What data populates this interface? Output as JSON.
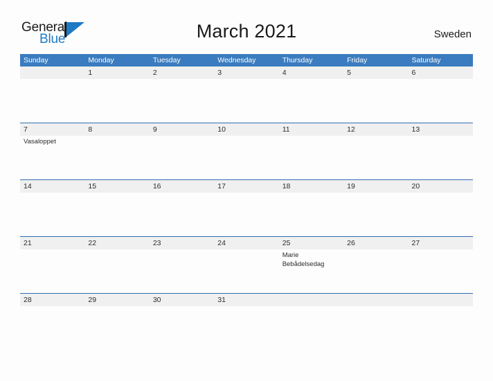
{
  "brand": {
    "name_part1": "General",
    "name_part2": "Blue",
    "accent_color": "#1f7ac4"
  },
  "header": {
    "title": "March 2021",
    "country": "Sweden"
  },
  "calendar": {
    "header_bg": "#3a7cbf",
    "band_bg": "#f0f0f0",
    "row_line_color": "#2f6daf",
    "weekdays": [
      "Sunday",
      "Monday",
      "Tuesday",
      "Wednesday",
      "Thursday",
      "Friday",
      "Saturday"
    ],
    "weeks": [
      [
        {
          "date": "",
          "events": []
        },
        {
          "date": "1",
          "events": []
        },
        {
          "date": "2",
          "events": []
        },
        {
          "date": "3",
          "events": []
        },
        {
          "date": "4",
          "events": []
        },
        {
          "date": "5",
          "events": []
        },
        {
          "date": "6",
          "events": []
        }
      ],
      [
        {
          "date": "7",
          "events": [
            "Vasaloppet"
          ]
        },
        {
          "date": "8",
          "events": []
        },
        {
          "date": "9",
          "events": []
        },
        {
          "date": "10",
          "events": []
        },
        {
          "date": "11",
          "events": []
        },
        {
          "date": "12",
          "events": []
        },
        {
          "date": "13",
          "events": []
        }
      ],
      [
        {
          "date": "14",
          "events": []
        },
        {
          "date": "15",
          "events": []
        },
        {
          "date": "16",
          "events": []
        },
        {
          "date": "17",
          "events": []
        },
        {
          "date": "18",
          "events": []
        },
        {
          "date": "19",
          "events": []
        },
        {
          "date": "20",
          "events": []
        }
      ],
      [
        {
          "date": "21",
          "events": []
        },
        {
          "date": "22",
          "events": []
        },
        {
          "date": "23",
          "events": []
        },
        {
          "date": "24",
          "events": []
        },
        {
          "date": "25",
          "events": [
            "Marie",
            "Bebådelsedag"
          ]
        },
        {
          "date": "26",
          "events": []
        },
        {
          "date": "27",
          "events": []
        }
      ],
      [
        {
          "date": "28",
          "events": []
        },
        {
          "date": "29",
          "events": []
        },
        {
          "date": "30",
          "events": []
        },
        {
          "date": "31",
          "events": []
        },
        {
          "date": "",
          "events": []
        },
        {
          "date": "",
          "events": []
        },
        {
          "date": "",
          "events": []
        }
      ]
    ]
  }
}
